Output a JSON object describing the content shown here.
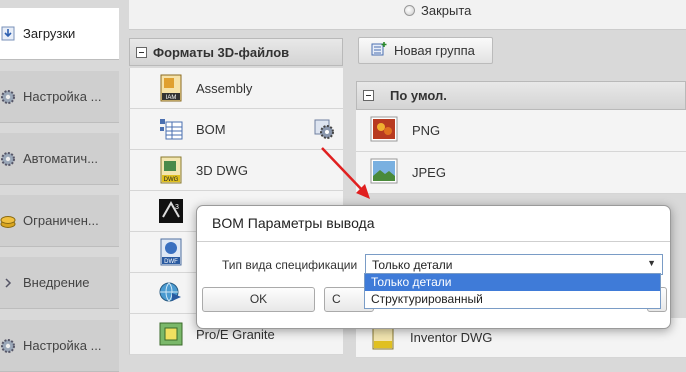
{
  "top": {
    "radio_label": "Закрыта"
  },
  "nav": {
    "items": [
      {
        "label": "Загрузки",
        "icon": "download-icon",
        "active": true
      },
      {
        "label": "Настройка ...",
        "icon": "gear-icon"
      },
      {
        "label": "Автоматич...",
        "icon": "gear-icon"
      },
      {
        "label": "Ограничен...",
        "icon": "coins-icon"
      },
      {
        "label": "Внедрение",
        "icon": "chevron-right-icon"
      },
      {
        "label": "Настройка ...",
        "icon": "gear-icon"
      }
    ]
  },
  "formats": {
    "header": "Форматы 3D-файлов",
    "items": [
      {
        "label": "Assembly",
        "icon": "iam-file-icon"
      },
      {
        "label": "BOM",
        "icon": "bom-table-icon"
      },
      {
        "label": "3D DWG",
        "icon": "dwg-file-icon"
      },
      {
        "label": "",
        "icon": "3ds-max-icon"
      },
      {
        "label": "",
        "icon": "dwf-file-icon"
      },
      {
        "label": "",
        "icon": "globe-arrow-icon"
      },
      {
        "label": "Pro/E Granite",
        "icon": "granite-icon"
      }
    ]
  },
  "toolbar": {
    "new_group_label": "Новая группа"
  },
  "groups": {
    "header": "По умол.",
    "items": [
      {
        "label": "PNG",
        "icon": "png-image-icon"
      },
      {
        "label": "JPEG",
        "icon": "jpeg-image-icon"
      }
    ],
    "bottom_item": {
      "label": "Inventor DWG",
      "icon": "inventor-dwg-icon"
    }
  },
  "dialog": {
    "title": "BOM Параметры вывода",
    "field_label": "Тип вида спецификации",
    "selected_value": "Только детали",
    "options": [
      "Только детали",
      "Структурированный"
    ],
    "ok_label": "OK",
    "cancel_partial": "C"
  },
  "colors": {
    "accent": "#3f7bd8",
    "arrow": "#e02020"
  }
}
